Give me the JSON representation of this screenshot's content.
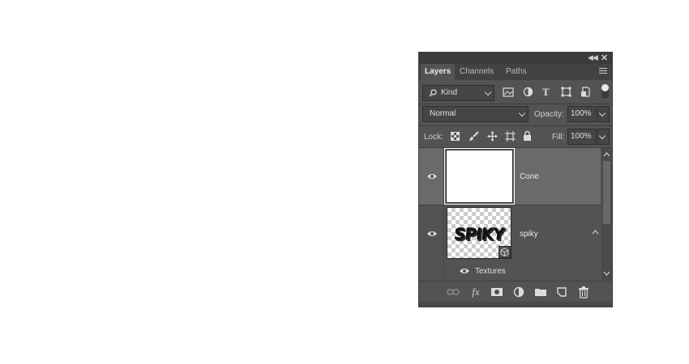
{
  "panel": {
    "tabs": [
      {
        "label": "Layers",
        "active": true
      },
      {
        "label": "Channels",
        "active": false
      },
      {
        "label": "Paths",
        "active": false
      }
    ],
    "filter": {
      "kind_label": "Kind",
      "icons": [
        "image-filter-icon",
        "adjustment-filter-icon",
        "type-filter-icon",
        "shape-filter-icon",
        "smart-object-filter-icon"
      ]
    },
    "blend": {
      "mode": "Normal",
      "opacity_label": "Opacity:",
      "opacity_value": "100%"
    },
    "lock": {
      "label": "Lock:",
      "icons": [
        "lock-transparent-icon",
        "lock-image-icon",
        "lock-position-icon",
        "lock-artboard-icon",
        "lock-all-icon"
      ],
      "fill_label": "Fill:",
      "fill_value": "100%"
    },
    "layers": [
      {
        "name": "Cone",
        "selected": true,
        "visible": true
      },
      {
        "name": "spiky",
        "selected": false,
        "visible": true,
        "sublayer": "Textures",
        "thumb_text": "SPIKY"
      }
    ],
    "bottom_icons": [
      "link-layers-icon",
      "fx-icon",
      "add-mask-icon",
      "adjustment-layer-icon",
      "group-folder-icon",
      "new-layer-icon",
      "trash-icon"
    ],
    "fx_label": "fx"
  }
}
